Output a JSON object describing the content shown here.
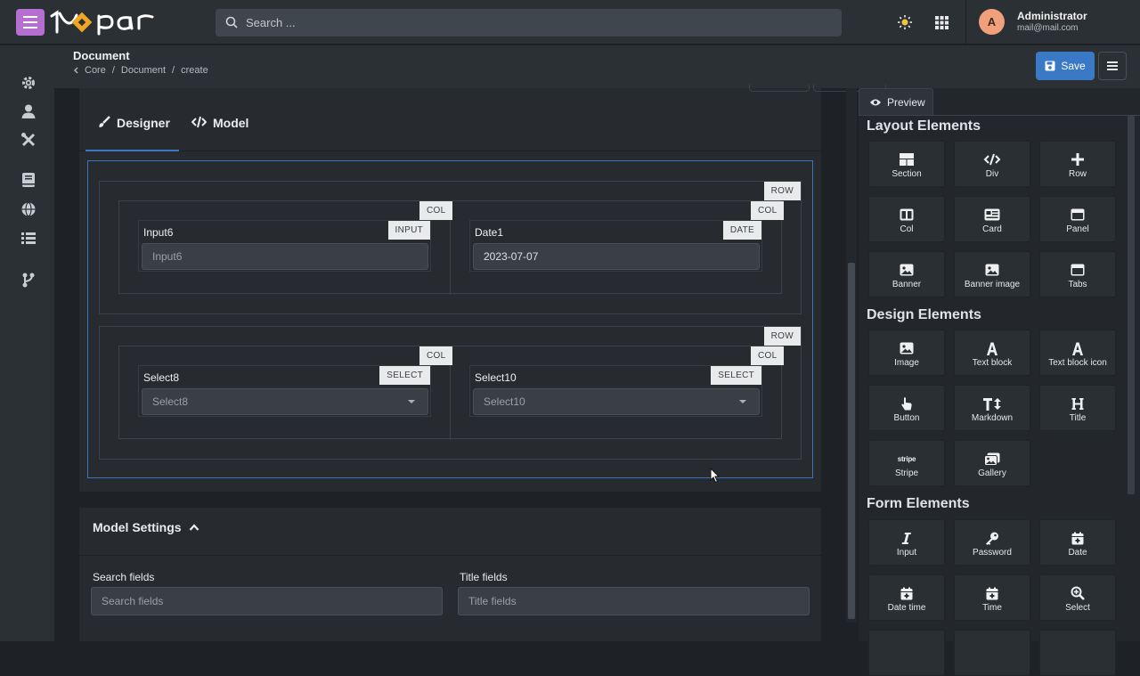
{
  "topbar": {
    "search_placeholder": "Search ...",
    "user": {
      "initial": "A",
      "name": "Administrator",
      "email": "mail@mail.com"
    },
    "brand_color": "#b56fd0"
  },
  "sidebar": {
    "items": [
      "gear-icon",
      "user-icon",
      "tools-icon",
      "book-icon",
      "globe-icon",
      "list-icon",
      "branch-icon"
    ]
  },
  "header": {
    "title": "Document",
    "breadcrumb": [
      "Core",
      "Document",
      "create"
    ],
    "save_label": "Save",
    "accent": "#3979c6"
  },
  "designer": {
    "tabs": [
      {
        "label": "Designer",
        "active": true
      },
      {
        "label": "Model",
        "active": false
      }
    ],
    "rows": [
      {
        "tag": "ROW",
        "cols": [
          {
            "tag": "COL",
            "field_type": "INPUT",
            "label": "Input6",
            "value": "",
            "placeholder": "Input6"
          },
          {
            "tag": "COL",
            "field_type": "DATE",
            "label": "Date1",
            "value": "2023-07-07",
            "placeholder": ""
          }
        ]
      },
      {
        "tag": "ROW",
        "cols": [
          {
            "tag": "COL",
            "field_type": "SELECT",
            "label": "Select8",
            "value": "",
            "placeholder": "Select8"
          },
          {
            "tag": "COL",
            "field_type": "SELECT",
            "label": "Select10",
            "value": "",
            "placeholder": "Select10"
          }
        ]
      }
    ]
  },
  "model_settings": {
    "title": "Model Settings",
    "search_fields": {
      "label": "Search fields",
      "placeholder": "Search fields"
    },
    "title_fields": {
      "label": "Title fields",
      "placeholder": "Title fields"
    }
  },
  "panel": {
    "preview_label": "Preview",
    "sections": [
      {
        "title": "Layout Elements",
        "items": [
          {
            "label": "Section",
            "icon": "section-icon"
          },
          {
            "label": "Div",
            "icon": "code-icon"
          },
          {
            "label": "Row",
            "icon": "plus-icon"
          },
          {
            "label": "Col",
            "icon": "columns-icon"
          },
          {
            "label": "Card",
            "icon": "card-icon"
          },
          {
            "label": "Panel",
            "icon": "panel-icon"
          },
          {
            "label": "Banner",
            "icon": "image-icon"
          },
          {
            "label": "Banner image",
            "icon": "image-icon"
          },
          {
            "label": "Tabs",
            "icon": "tabs-icon"
          }
        ]
      },
      {
        "title": "Design Elements",
        "items": [
          {
            "label": "Image",
            "icon": "image-icon"
          },
          {
            "label": "Text block",
            "icon": "letter-a-icon"
          },
          {
            "label": "Text block icon",
            "icon": "letter-a-icon"
          },
          {
            "label": "Button",
            "icon": "pointer-icon"
          },
          {
            "label": "Markdown",
            "icon": "text-height-icon"
          },
          {
            "label": "Title",
            "icon": "heading-icon"
          },
          {
            "label": "Stripe",
            "icon": "stripe-icon",
            "glyph": "stripe"
          },
          {
            "label": "Gallery",
            "icon": "images-icon"
          }
        ]
      },
      {
        "title": "Form Elements",
        "items": [
          {
            "label": "Input",
            "icon": "italic-icon"
          },
          {
            "label": "Password",
            "icon": "key-icon"
          },
          {
            "label": "Date",
            "icon": "calendar-icon"
          },
          {
            "label": "Date time",
            "icon": "calendar-icon"
          },
          {
            "label": "Time",
            "icon": "calendar-icon"
          },
          {
            "label": "Select",
            "icon": "search-plus-icon"
          }
        ]
      }
    ]
  }
}
